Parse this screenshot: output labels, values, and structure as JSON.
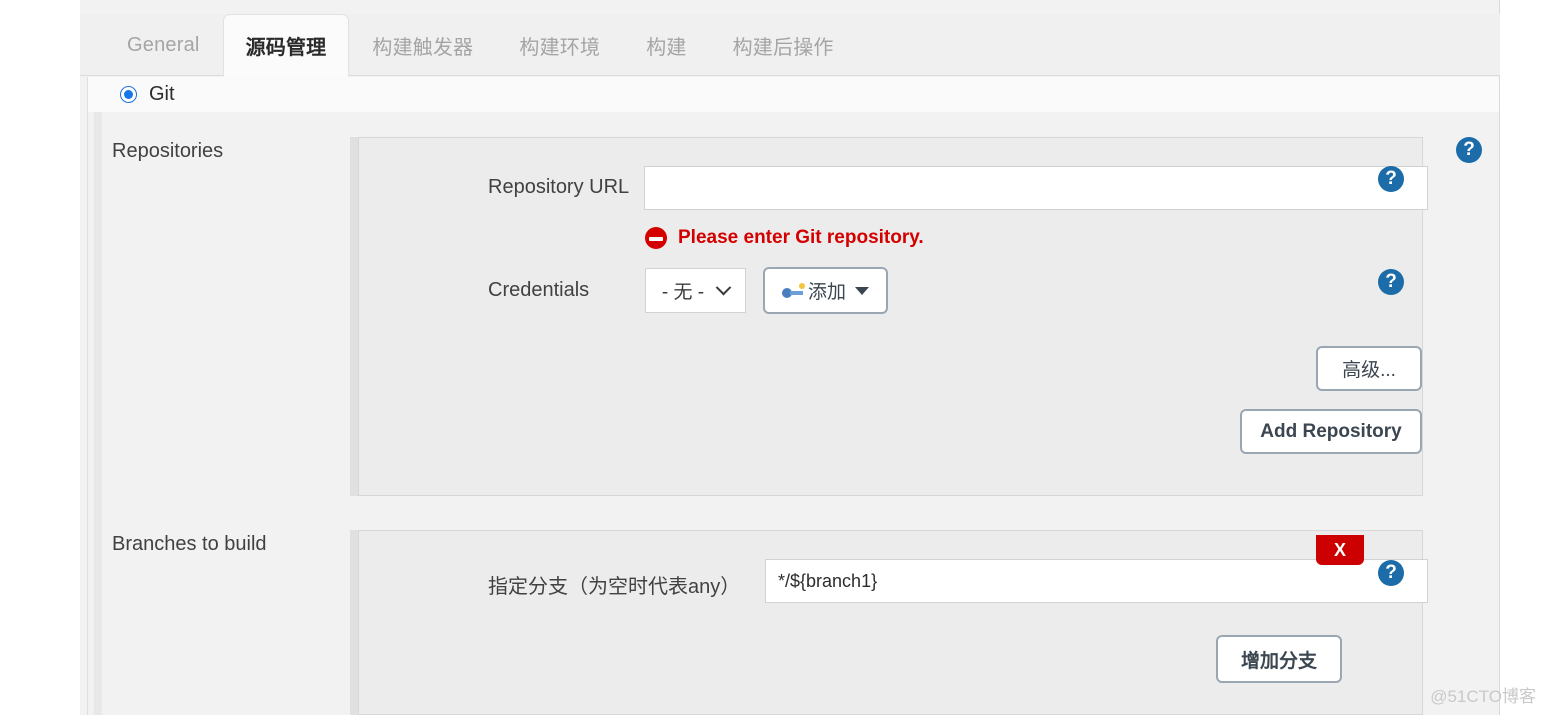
{
  "tabs": [
    {
      "label": "General",
      "active": false
    },
    {
      "label": "源码管理",
      "active": true
    },
    {
      "label": "构建触发器",
      "active": false
    },
    {
      "label": "构建环境",
      "active": false
    },
    {
      "label": "构建",
      "active": false
    },
    {
      "label": "构建后操作",
      "active": false
    }
  ],
  "scm": {
    "selected_label": "Git"
  },
  "repositories": {
    "section_label": "Repositories",
    "url_label": "Repository URL",
    "url_value": "",
    "url_placeholder": "",
    "error_text": "Please enter Git repository.",
    "error_icon": "error-circle-icon",
    "credentials_label": "Credentials",
    "credentials_value": "- 无 -",
    "credentials_options": [
      "- 无 -"
    ],
    "add_credentials_label": "添加",
    "add_credentials_icon": "key-icon",
    "advanced_label": "高级...",
    "add_repository_label": "Add Repository"
  },
  "branches": {
    "section_label": "Branches to build",
    "branch_label": "指定分支（为空时代表any）",
    "branch_value": "*/${branch1}",
    "branch_placeholder": "",
    "delete_label": "X",
    "add_branch_label": "增加分支"
  },
  "help": {
    "glyph": "?"
  },
  "watermark": {
    "text": "@51CTO博客"
  },
  "colors": {
    "accent_blue": "#1b6ca8",
    "error_red": "#d40000",
    "delete_red": "#cc0000",
    "radio_blue": "#1577e8",
    "panel_bg": "#ececec",
    "page_bg": "#f2f2f2"
  }
}
